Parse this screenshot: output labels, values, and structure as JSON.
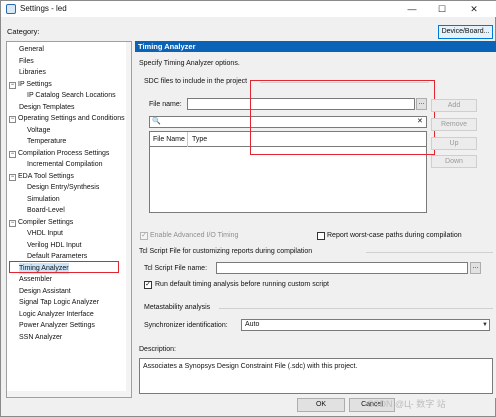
{
  "window": {
    "title": "Settings - led",
    "controls": {
      "minimize": "—",
      "maximize": "☐",
      "close": "✕"
    }
  },
  "category_label": "Category:",
  "device_board_button": "Device/Board...",
  "sidebar": {
    "items": [
      {
        "label": "General",
        "indent": 0,
        "expander": ""
      },
      {
        "label": "Files",
        "indent": 0,
        "expander": ""
      },
      {
        "label": "Libraries",
        "indent": 0,
        "expander": ""
      },
      {
        "label": "IP Settings",
        "indent": 0,
        "expander": "−"
      },
      {
        "label": "IP Catalog Search Locations",
        "indent": 1,
        "expander": ""
      },
      {
        "label": "Design Templates",
        "indent": 0,
        "expander": ""
      },
      {
        "label": "Operating Settings and Conditions",
        "indent": 0,
        "expander": "−"
      },
      {
        "label": "Voltage",
        "indent": 1,
        "expander": ""
      },
      {
        "label": "Temperature",
        "indent": 1,
        "expander": ""
      },
      {
        "label": "Compilation Process Settings",
        "indent": 0,
        "expander": "−"
      },
      {
        "label": "Incremental Compilation",
        "indent": 1,
        "expander": ""
      },
      {
        "label": "EDA Tool Settings",
        "indent": 0,
        "expander": "−"
      },
      {
        "label": "Design Entry/Synthesis",
        "indent": 1,
        "expander": ""
      },
      {
        "label": "Simulation",
        "indent": 1,
        "expander": ""
      },
      {
        "label": "Board-Level",
        "indent": 1,
        "expander": ""
      },
      {
        "label": "Compiler Settings",
        "indent": 0,
        "expander": "−"
      },
      {
        "label": "VHDL Input",
        "indent": 1,
        "expander": ""
      },
      {
        "label": "Verilog HDL Input",
        "indent": 1,
        "expander": ""
      },
      {
        "label": "Default Parameters",
        "indent": 1,
        "expander": ""
      },
      {
        "label": "Timing Analyzer",
        "indent": 0,
        "expander": "",
        "selected": true
      },
      {
        "label": "Assembler",
        "indent": 0,
        "expander": ""
      },
      {
        "label": "Design Assistant",
        "indent": 0,
        "expander": ""
      },
      {
        "label": "Signal Tap Logic Analyzer",
        "indent": 0,
        "expander": ""
      },
      {
        "label": "Logic Analyzer Interface",
        "indent": 0,
        "expander": ""
      },
      {
        "label": "Power Analyzer Settings",
        "indent": 0,
        "expander": ""
      },
      {
        "label": "SSN Analyzer",
        "indent": 0,
        "expander": ""
      }
    ]
  },
  "panel": {
    "header": "Timing Analyzer",
    "subtitle": "Specify Timing Analyzer options.",
    "sdc": {
      "group_title": "SDC files to include in the project",
      "file_name_label": "File name:",
      "file_name_value": "",
      "browse_label": "...",
      "search_value": "",
      "clear_label": "✕",
      "table_headers": [
        "File Name",
        "Type"
      ],
      "buttons": {
        "add": "Add",
        "remove": "Remove",
        "up": "Up",
        "down": "Down"
      }
    },
    "enable_io_label": "Enable Advanced I/O Timing",
    "report_worst_label": "Report worst-case paths during compilation",
    "tcl": {
      "group_title": "Tcl Script File for customizing reports during compilation",
      "file_label": "Tcl Script File name:",
      "file_value": "",
      "browse_label": "...",
      "run_default_label": "Run default timing analysis before running custom script"
    },
    "meta": {
      "group_title": "Metastability analysis",
      "sync_label": "Synchronizer identification:",
      "sync_value": "Auto"
    },
    "description": {
      "label": "Description:",
      "text": "Associates a Synopsys Design Constraint File (.sdc) with this project."
    }
  },
  "footer": {
    "ok": "OK",
    "cancel": "Cancel",
    "watermark": "CSDN @Ц- 数字 站"
  }
}
